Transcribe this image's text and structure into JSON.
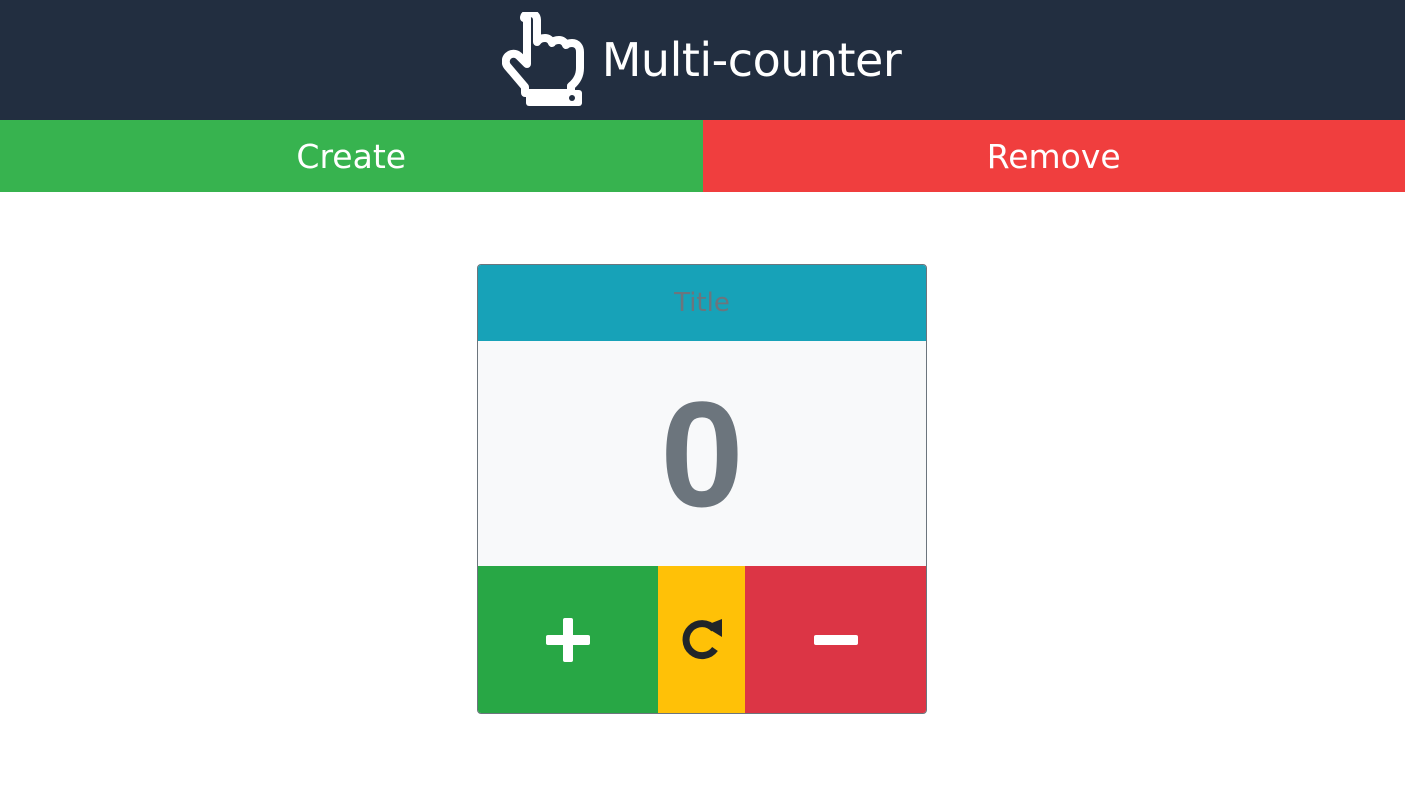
{
  "header": {
    "title": "Multi-counter",
    "logo_icon": "pointing-hand-icon"
  },
  "actions": {
    "create_label": "Create",
    "remove_label": "Remove"
  },
  "counter": {
    "title_placeholder": "Title",
    "title_value": "",
    "value": "0",
    "increment_icon": "plus-icon",
    "reset_icon": "redo-icon",
    "decrement_icon": "minus-icon"
  },
  "colors": {
    "header_bg": "#222e40",
    "create_bg": "#37b34f",
    "remove_bg": "#f03e3e",
    "card_title_bg": "#17a2b8",
    "increment_bg": "#28a745",
    "reset_bg": "#ffc107",
    "decrement_bg": "#dc3545",
    "value_color": "#6c757d"
  }
}
